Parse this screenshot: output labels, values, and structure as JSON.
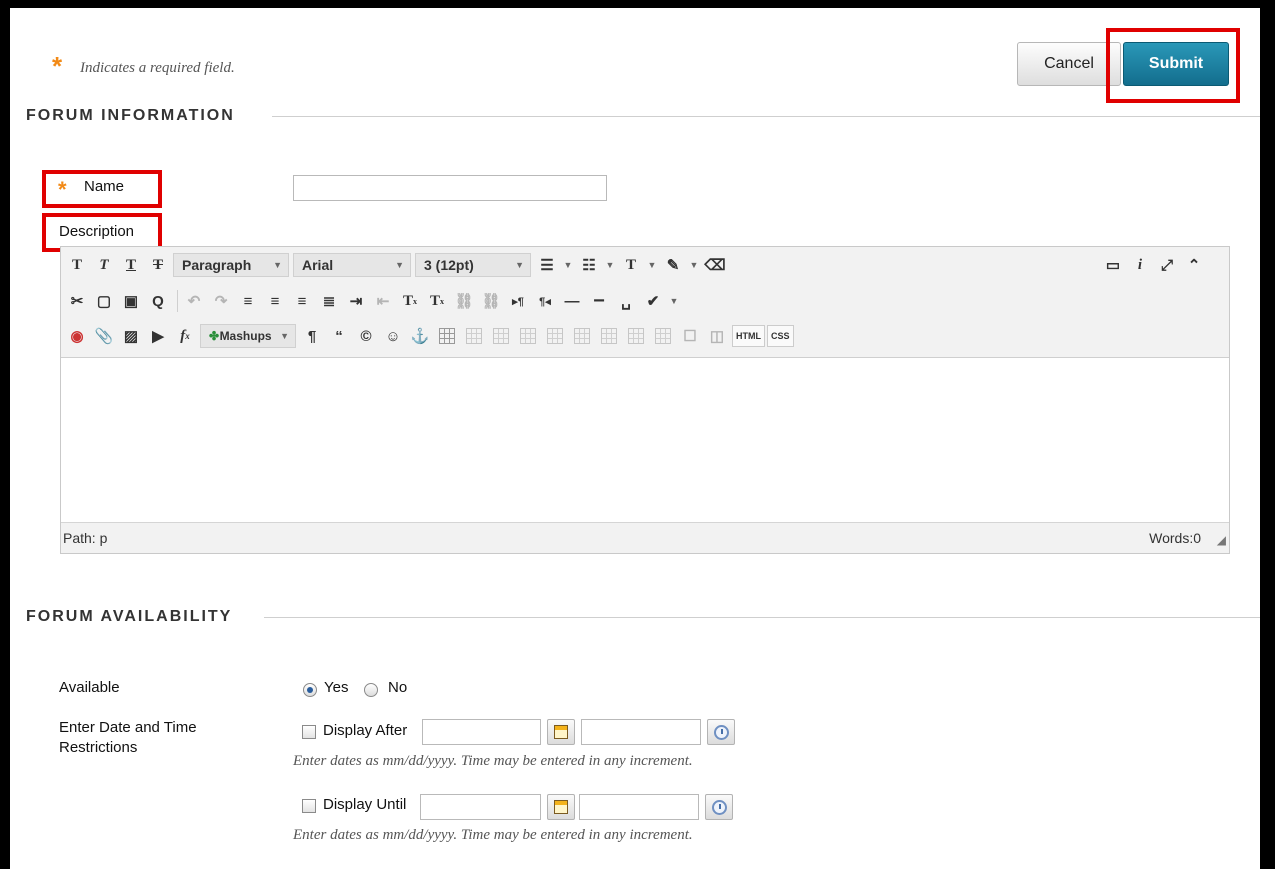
{
  "required_note": "Indicates a required field.",
  "actions": {
    "cancel_label": "Cancel",
    "submit_label": "Submit"
  },
  "forum_information": {
    "heading": "FORUM INFORMATION",
    "name_label": "Name",
    "name_value": "",
    "description_label": "Description"
  },
  "editor": {
    "paragraph_select": "Paragraph",
    "font_select": "Arial",
    "size_select": "3 (12pt)",
    "mashups_label": "Mashups",
    "html_label": "HTML",
    "css_label": "CSS",
    "path_text": "Path: p",
    "words_text": "Words:0"
  },
  "forum_availability": {
    "heading": "FORUM AVAILABILITY",
    "available_label": "Available",
    "yes_label": "Yes",
    "no_label": "No",
    "selected": "Yes",
    "date_label": "Enter Date and Time Restrictions",
    "display_after_label": "Display After",
    "display_until_label": "Display Until",
    "hint_text": "Enter dates as mm/dd/yyyy. Time may be entered in any increment."
  }
}
